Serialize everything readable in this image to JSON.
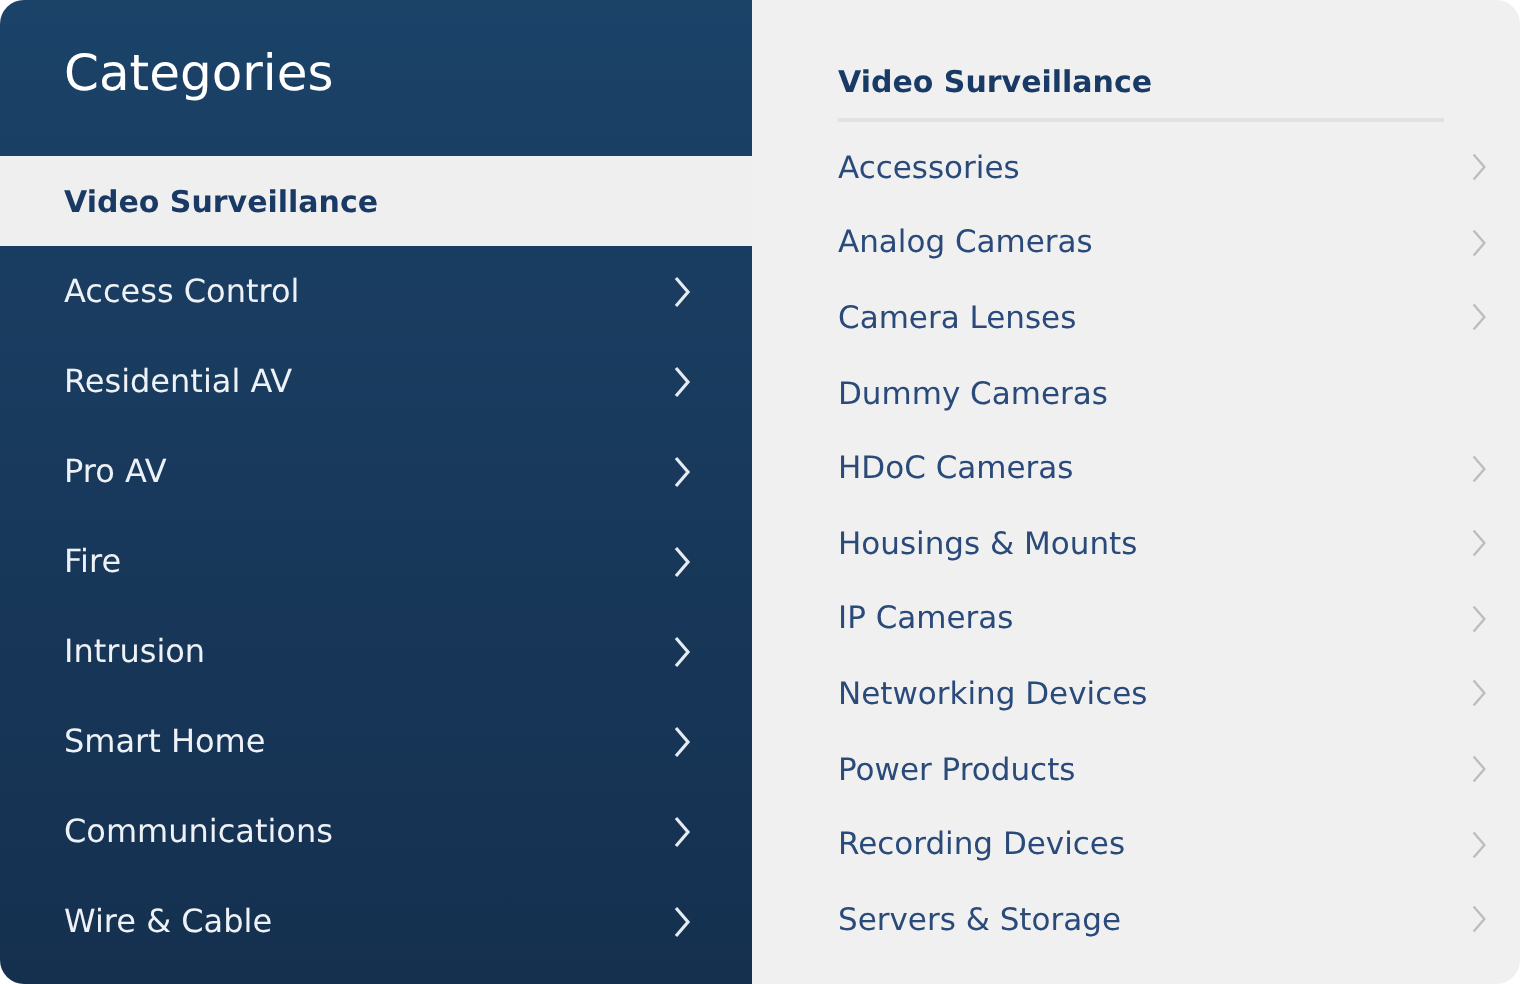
{
  "sidebar": {
    "title": "Categories",
    "items": [
      {
        "label": "Video Surveillance",
        "selected": true,
        "expandable": false
      },
      {
        "label": "Access Control",
        "selected": false,
        "expandable": true
      },
      {
        "label": "Residential AV",
        "selected": false,
        "expandable": true
      },
      {
        "label": "Pro AV",
        "selected": false,
        "expandable": true
      },
      {
        "label": "Fire",
        "selected": false,
        "expandable": true
      },
      {
        "label": "Intrusion",
        "selected": false,
        "expandable": true
      },
      {
        "label": "Smart Home",
        "selected": false,
        "expandable": true
      },
      {
        "label": "Communications",
        "selected": false,
        "expandable": true
      },
      {
        "label": "Wire & Cable",
        "selected": false,
        "expandable": true
      }
    ]
  },
  "subcategories": {
    "title": "Video Surveillance",
    "items": [
      {
        "label": "Accessories",
        "expandable": true
      },
      {
        "label": "Analog Cameras",
        "expandable": true
      },
      {
        "label": "Camera Lenses",
        "expandable": true
      },
      {
        "label": "Dummy Cameras",
        "expandable": false
      },
      {
        "label": "HDoC Cameras",
        "expandable": true
      },
      {
        "label": "Housings & Mounts",
        "expandable": true
      },
      {
        "label": "IP Cameras",
        "expandable": true
      },
      {
        "label": "Networking Devices",
        "expandable": true
      },
      {
        "label": "Power Products",
        "expandable": true
      },
      {
        "label": "Recording Devices",
        "expandable": true
      },
      {
        "label": "Servers & Storage",
        "expandable": true
      }
    ]
  }
}
